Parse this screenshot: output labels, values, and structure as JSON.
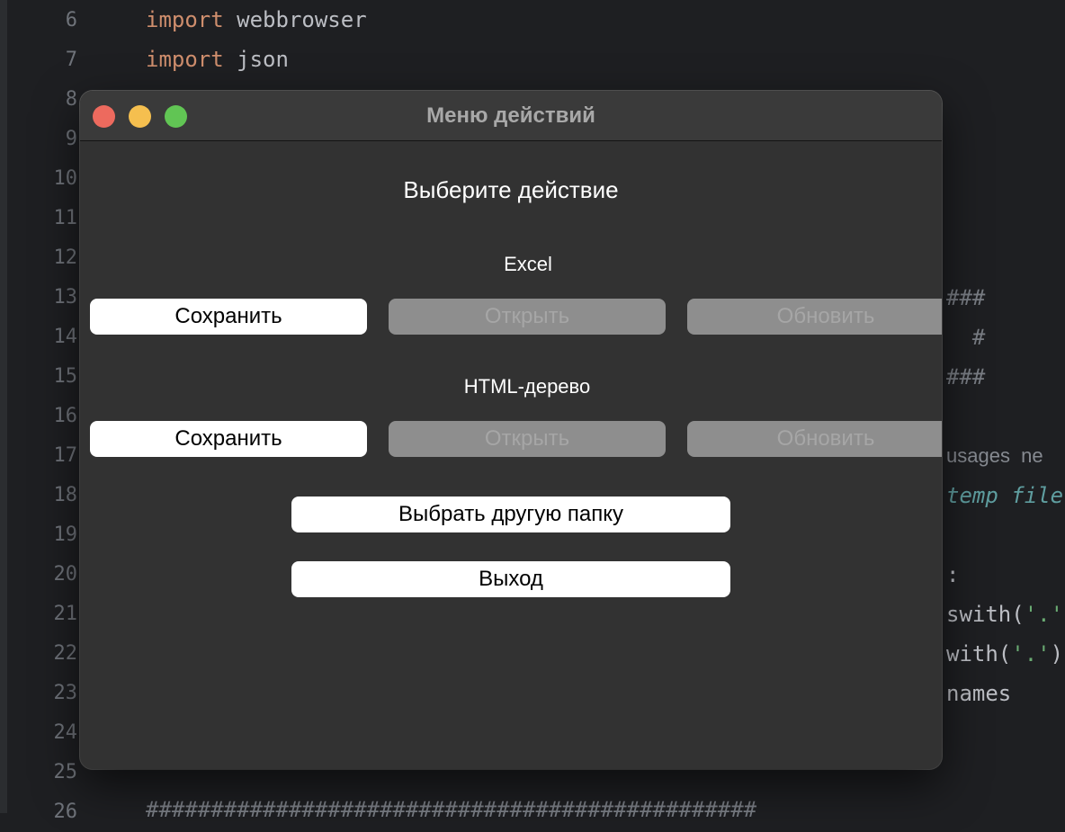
{
  "editor": {
    "line_numbers": [
      "6",
      "7",
      "8",
      "9",
      "10",
      "11",
      "12",
      "13",
      "14",
      "15",
      "16",
      "17",
      "18",
      "19",
      "20",
      "21",
      "22",
      "23",
      "24",
      "25",
      "26"
    ],
    "code": [
      {
        "keyword": "import",
        "rest": " webbrowser"
      },
      {
        "keyword": "import",
        "rest": " json"
      }
    ],
    "fragments": {
      "l13": "###",
      "l14": "  #",
      "l15": "###",
      "l17": "usages  ne",
      "l18": "temp file",
      "l20": ":",
      "l21_a": "swith(",
      "l21_b": "'.'",
      "l22_a": "with(",
      "l22_b": "'.'",
      "l22_c": ")",
      "l23": "names"
    },
    "bottom_comment": "###############################################"
  },
  "window": {
    "title": "Меню действий",
    "heading": "Выберите действие",
    "excel": {
      "label": "Excel",
      "save": "Сохранить",
      "open": "Открыть",
      "update": "Обновить"
    },
    "html_tree": {
      "label": "HTML-дерево",
      "save": "Сохранить",
      "open": "Открыть",
      "update": "Обновить"
    },
    "choose_folder": "Выбрать другую папку",
    "exit": "Выход"
  }
}
